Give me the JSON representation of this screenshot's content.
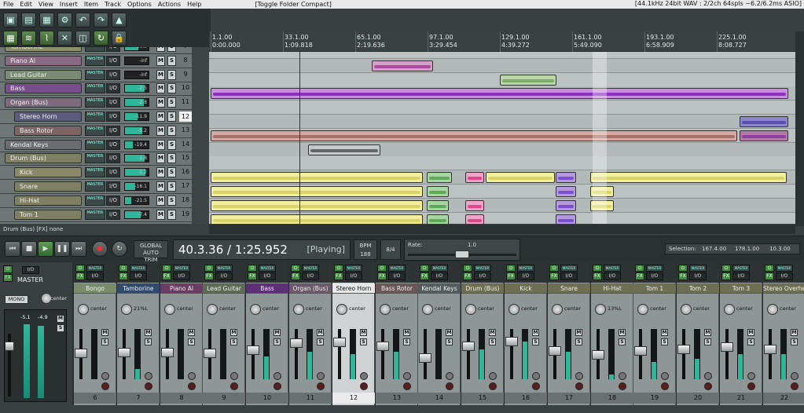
{
  "menu": {
    "items": [
      "File",
      "Edit",
      "View",
      "Insert",
      "Item",
      "Track",
      "Options",
      "Actions",
      "Help"
    ],
    "toggle_label": "[Toggle Folder Compact]",
    "audio_info": "[44.1kHz 24bit WAV : 2/2ch 64spls ~6.2/6.2ms ASIO]"
  },
  "toolbar": {
    "buttons": [
      {
        "icon": "new-project-icon",
        "glyph": "▣"
      },
      {
        "icon": "open-project-icon",
        "glyph": "▤"
      },
      {
        "icon": "save-project-icon",
        "glyph": "▦"
      },
      {
        "icon": "settings-icon",
        "glyph": "⚙"
      },
      {
        "icon": "undo-icon",
        "glyph": "↶"
      },
      {
        "icon": "redo-icon",
        "glyph": "↷"
      },
      {
        "icon": "metronome-icon",
        "glyph": "▲"
      },
      {
        "icon": "snap-grid-icon",
        "glyph": "▦"
      },
      {
        "icon": "ripple-edit-icon",
        "glyph": "≋"
      },
      {
        "icon": "envelope-icon",
        "glyph": "⌇"
      },
      {
        "icon": "crossfade-icon",
        "glyph": "✕"
      },
      {
        "icon": "group-icon",
        "glyph": "◫"
      },
      {
        "icon": "repeat-icon",
        "glyph": "↻"
      },
      {
        "icon": "lock-icon",
        "glyph": "🔒"
      }
    ]
  },
  "ruler": {
    "markers": [
      {
        "bar": "1.1.00",
        "time": "0:00.000"
      },
      {
        "bar": "33.1.00",
        "time": "1:09.818"
      },
      {
        "bar": "65.1.00",
        "time": "2:19.636"
      },
      {
        "bar": "97.1.00",
        "time": "3:29.454"
      },
      {
        "bar": "129.1.00",
        "time": "4:39.272"
      },
      {
        "bar": "161.1.00",
        "time": "5:49.090"
      },
      {
        "bar": "193.1.00",
        "time": "6:58.909"
      },
      {
        "bar": "225.1.00",
        "time": "8:08.727"
      }
    ]
  },
  "tracks": [
    {
      "name": "Tamborine",
      "vol": "-10.9",
      "num": "7",
      "color": "#8b8f6c",
      "indent": 0
    },
    {
      "name": "Piano Al",
      "vol": "-inf",
      "num": "8",
      "color": "#8a6a83",
      "indent": 0
    },
    {
      "name": "Lead Guitar",
      "vol": "-inf",
      "num": "9",
      "color": "#7a8a73",
      "indent": 0
    },
    {
      "name": "Bass",
      "vol": "-2.5",
      "num": "10",
      "color": "#7a4d8f",
      "indent": 0
    },
    {
      "name": "Organ (Bus)",
      "vol": "-2.8",
      "num": "11",
      "color": "#7d6a7d",
      "indent": 0
    },
    {
      "name": "Stereo Horn",
      "vol": "-11.9",
      "num": "12",
      "color": "#5e5a7f",
      "indent": 1
    },
    {
      "name": "Bass Rotor",
      "vol": "-5.2",
      "num": "13",
      "color": "#7d6565",
      "indent": 1
    },
    {
      "name": "Kendal Keys",
      "vol": "-19.4",
      "num": "14",
      "color": "#6b6d6f",
      "indent": 0
    },
    {
      "name": "Drum (Bus)",
      "vol": "-1.8",
      "num": "15",
      "color": "#7f7f64",
      "indent": 0
    },
    {
      "name": "Kick",
      "vol": "-1.2",
      "num": "16",
      "color": "#8a8868",
      "indent": 1
    },
    {
      "name": "Snare",
      "vol": "-16.1",
      "num": "17",
      "color": "#7f7f64",
      "indent": 1
    },
    {
      "name": "Hi-Hat",
      "vol": "-21.5",
      "num": "18",
      "color": "#7f7f64",
      "indent": 1
    },
    {
      "name": "Tom 1",
      "vol": "-7.4",
      "num": "19",
      "color": "#7f7f64",
      "indent": 1
    }
  ],
  "track_labels": {
    "master_send": "MASTER",
    "io": "I/O",
    "mute": "M",
    "solo": "S"
  },
  "status_text": "Drum (Bus) [FX] none",
  "transport": {
    "time": "40.3.36 / 1:25.952",
    "state": "[Playing]",
    "bpm_label": "BPM",
    "bpm": "188",
    "signature": "8/4",
    "rate_label": "Rate:",
    "rate": "1.0",
    "global_auto": "GLOBAL AUTO",
    "global_auto_sub": "TRIM",
    "selection_label": "Selection:",
    "selection_start": "167.4.00",
    "selection_end": "178.1.00",
    "selection_len": "10.3.00"
  },
  "master": {
    "name": "MASTER",
    "mono": "MONO",
    "pan": "center",
    "peak_l": "-5.1",
    "peak_r": "-4.9",
    "io": "I/O",
    "fx": "FX"
  },
  "mixer": {
    "strips": [
      {
        "name": "Bongo",
        "pan": "center",
        "num": "6",
        "color": "#7a8a6c",
        "fader": 0.55,
        "meter": 0.0,
        "selected": false
      },
      {
        "name": "Tamborine",
        "pan": "21%L",
        "num": "7",
        "color": "#2f4a6a",
        "fader": 0.58,
        "meter": 0.2,
        "selected": false
      },
      {
        "name": "Piano Al",
        "pan": "center",
        "num": "8",
        "color": "#6a3e63",
        "fader": 0.58,
        "meter": 0.0,
        "selected": false
      },
      {
        "name": "Lead Guitar",
        "pan": "center",
        "num": "9",
        "color": "#5d6a55",
        "fader": 0.55,
        "meter": 0.0,
        "selected": false
      },
      {
        "name": "Bass",
        "pan": "center",
        "num": "10",
        "color": "#5d2f77",
        "fader": 0.62,
        "meter": 0.45,
        "selected": false
      },
      {
        "name": "Organ (Bus)",
        "pan": "center",
        "num": "11",
        "color": "#6a5a6a",
        "fader": 0.78,
        "meter": 0.55,
        "selected": false
      },
      {
        "name": "Stereo Horn",
        "pan": "center",
        "num": "12",
        "color": "#cfd3d3",
        "fader": 0.8,
        "meter": 0.5,
        "selected": true
      },
      {
        "name": "Bass Rotor",
        "pan": "center",
        "num": "13",
        "color": "#6a5757",
        "fader": 0.72,
        "meter": 0.55,
        "selected": false
      },
      {
        "name": "Kendal Keys",
        "pan": "center",
        "num": "14",
        "color": "#555b5e",
        "fader": 0.45,
        "meter": 0.0,
        "selected": false
      },
      {
        "name": "Drum (Bus)",
        "pan": "center",
        "num": "15",
        "color": "#6e6e52",
        "fader": 0.72,
        "meter": 0.6,
        "selected": false
      },
      {
        "name": "Kick",
        "pan": "center",
        "num": "16",
        "color": "#6e6e52",
        "fader": 0.82,
        "meter": 0.75,
        "selected": false
      },
      {
        "name": "Snare",
        "pan": "center",
        "num": "17",
        "color": "#6e6e52",
        "fader": 0.6,
        "meter": 0.55,
        "selected": false
      },
      {
        "name": "Hi-Hat",
        "pan": "13%L",
        "num": "18",
        "color": "#6e6e52",
        "fader": 0.52,
        "meter": 0.1,
        "selected": false
      },
      {
        "name": "Tom 1",
        "pan": "center",
        "num": "19",
        "color": "#6e6e52",
        "fader": 0.6,
        "meter": 0.35,
        "selected": false
      },
      {
        "name": "Tom 2",
        "pan": "center",
        "num": "20",
        "color": "#6e6e52",
        "fader": 0.65,
        "meter": 0.4,
        "selected": false
      },
      {
        "name": "Tom 3",
        "pan": "center",
        "num": "21",
        "color": "#6e6e52",
        "fader": 0.7,
        "meter": 0.5,
        "selected": false
      },
      {
        "name": "Stereo Overhe",
        "pan": "center",
        "num": "22",
        "color": "#6e6e52",
        "fader": 0.65,
        "meter": 0.5,
        "selected": false
      }
    ],
    "strip_labels": {
      "master": "MASTER",
      "io": "I/O",
      "fx": "FX",
      "power": "⏻",
      "mute": "M",
      "solo": "S"
    }
  }
}
